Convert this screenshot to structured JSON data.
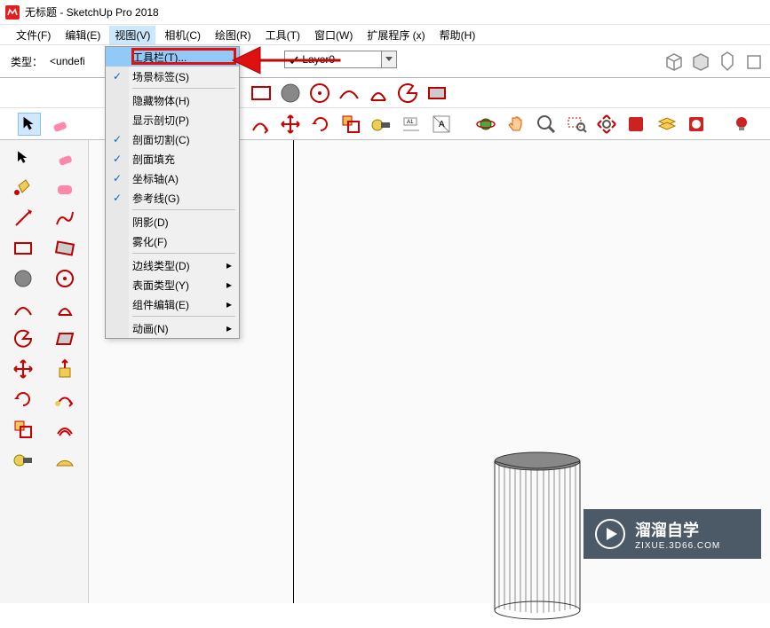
{
  "title": "无标题 - SketchUp Pro 2018",
  "menubar": {
    "file": "文件(F)",
    "edit": "编辑(E)",
    "view": "视图(V)",
    "camera": "相机(C)",
    "draw": "绘图(R)",
    "tools": "工具(T)",
    "window": "窗口(W)",
    "extensions": "扩展程序 (x)",
    "help": "帮助(H)"
  },
  "toolbar": {
    "type_label": "类型：",
    "type_value": "<undefi",
    "layer_value": "Layer0"
  },
  "dropdown": {
    "toolbars": "工具栏(T)...",
    "scene_tabs": "场景标签(S)",
    "hidden_geometry": "隐藏物体(H)",
    "section_planes": "显示剖切(P)",
    "section_cuts": "剖面切割(C)",
    "section_fill": "剖面填充",
    "axes": "坐标轴(A)",
    "guides": "参考线(G)",
    "shadows": "阴影(D)",
    "fog": "雾化(F)",
    "edge_style": "边线类型(D)",
    "face_style": "表面类型(Y)",
    "component_edit": "组件编辑(E)",
    "animation": "动画(N)"
  },
  "watermark": {
    "title": "溜溜自学",
    "url": "ZIXUE.3D66.COM"
  }
}
